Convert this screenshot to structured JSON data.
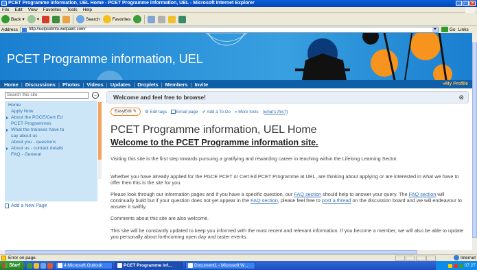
{
  "window": {
    "title": "PCET Programme information, UEL Home - PCET Programme information, UEL - Microsoft Internet Explorer"
  },
  "menu": [
    "File",
    "Edit",
    "View",
    "Favorites",
    "Tools",
    "Help"
  ],
  "toolbar": {
    "back": "Back",
    "search": "Search",
    "favorites": "Favorites"
  },
  "address": {
    "label": "Address",
    "url": "http://uelpcetinfo.wetpaint.com/",
    "go": "Go",
    "links": "Links"
  },
  "site": {
    "title": "PCET Programme information, UEL",
    "nav": [
      "Home",
      "Discussions",
      "Photos",
      "Videos",
      "Updates",
      "Droplets",
      "Members",
      "Invite"
    ],
    "my_profile": "My Profile",
    "search_placeholder": "Search this site",
    "sidebar": [
      {
        "label": "Home",
        "sub": false,
        "arrow": false
      },
      {
        "label": "Apply Now",
        "sub": true,
        "arrow": false
      },
      {
        "label": "About the PGCE/Cert Ed",
        "sub": true,
        "arrow": true
      },
      {
        "label": "PCET Programmes",
        "sub": true,
        "arrow": false
      },
      {
        "label": "What the trainees have to",
        "sub": true,
        "arrow": true
      },
      {
        "label": "say about us",
        "sub": true,
        "arrow": false
      },
      {
        "label": "About you - questions",
        "sub": true,
        "arrow": false
      },
      {
        "label": "About us - contact details",
        "sub": true,
        "arrow": true
      },
      {
        "label": "FAQ - General",
        "sub": true,
        "arrow": false
      }
    ],
    "add_page": "Add a New Page"
  },
  "welcome": "Welcome and feel free to browse!",
  "tools": {
    "easyedit": "EasyEdit",
    "edit_tags": "Edit tags",
    "email_page": "Email page",
    "add_todo": "Add a To-Do",
    "more_tools": "» More tools",
    "whats_this": "(what's this?)"
  },
  "page": {
    "title": "PCET Programme information, UEL Home",
    "subtitle": "Welcome to the PCET Programme information site.",
    "p1": "Visiting this site is the first step towards pursuing a gratifying and rewarding career in teaching within the Lifelong Learning Sector.",
    "p2": "Whether you have already applied for the PGCE PCET or Cert Ed PCET Programme at UEL, are thinking about applying or are interested in what we have to offer then this is the site for you.",
    "p3a": "Please look through our information pages and if you have a specific question, our ",
    "p3link1": "FAQ section",
    "p3b": " should help to answer your query. The ",
    "p3link2": "FAQ section",
    "p3c": " will continually build but if your question does not yet appear in the ",
    "p3link3": "FAQ section",
    "p3d": ", please feel free to ",
    "p3link4": "post a thread",
    "p3e": " on the discussion board and we will endeavour to answer it swiftly.",
    "p4": "Comments about this site are also welcome.",
    "p5": "This site will be constantly updated to keep you informed with the most recent and relevant information. If you become a member, we will also be able to update you personally about forthcoming open day and taster events."
  },
  "status": {
    "text": "Error on page.",
    "zone": "Internet"
  },
  "taskbar": {
    "start": "Start",
    "tasks": [
      "4 Microsoft Outlook",
      "PCET Programme inf...",
      "Document1 - Microsoft W..."
    ],
    "clock": "07:27"
  }
}
